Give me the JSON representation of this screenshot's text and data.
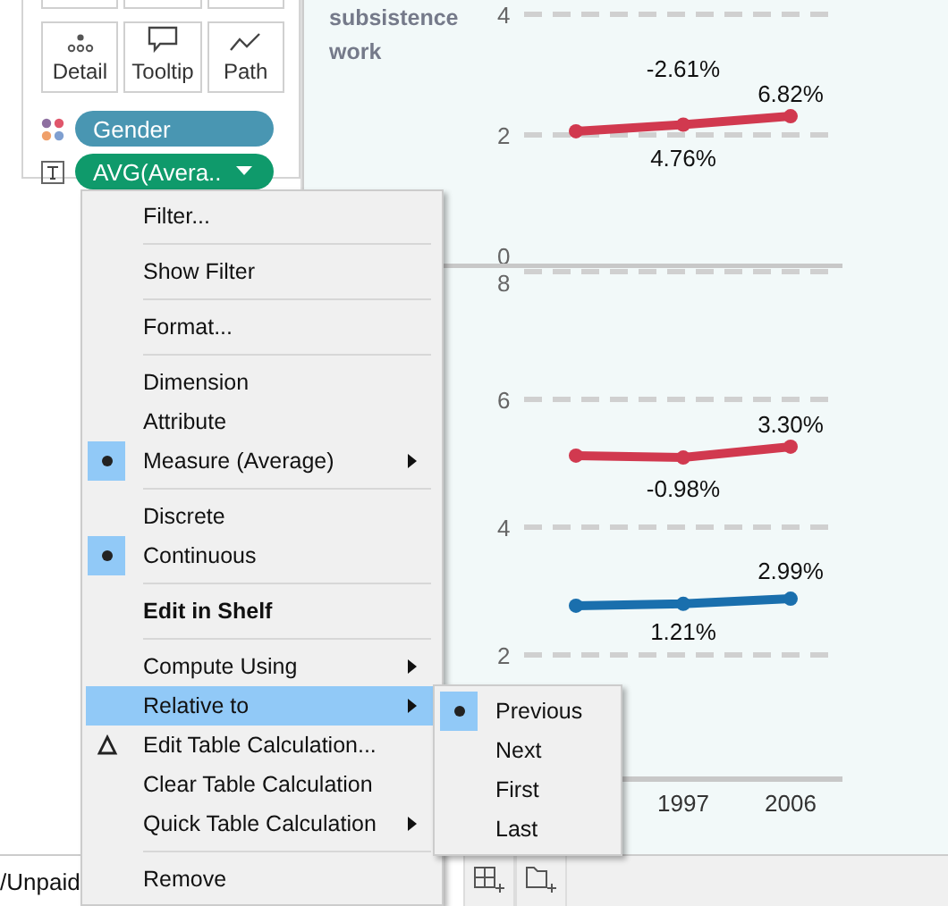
{
  "marks_card": {
    "buttons": [
      {
        "label": "Detail"
      },
      {
        "label": "Tooltip"
      },
      {
        "label": "Path"
      }
    ],
    "pills": [
      {
        "label": "Gender",
        "color": "#4996b2",
        "dropdown": false
      },
      {
        "label": "AVG(Avera..",
        "color": "#0f9a6b",
        "dropdown": true
      }
    ]
  },
  "row_header": "subsistence work",
  "panes": [
    {
      "chart_data": {
        "type": "line",
        "ylim": [
          0,
          4
        ],
        "yticks": [
          0,
          2,
          4
        ],
        "grid": true,
        "series": [
          {
            "color": "#d1394f",
            "marker": "circle",
            "values": [
              2.06,
              2.17,
              2.31
            ]
          }
        ],
        "annotations": [
          "-2.61%",
          "6.82%",
          "4.76%"
        ]
      }
    },
    {
      "chart_data": {
        "type": "line",
        "categories": [
          null,
          "1997",
          "2006"
        ],
        "ylim": [
          0,
          8
        ],
        "yticks": [
          2,
          4,
          6,
          8
        ],
        "grid": true,
        "series": [
          {
            "color": "#d1394f",
            "marker": "circle",
            "values": [
              5.12,
              5.09,
              5.26
            ]
          },
          {
            "color": "#1a6fad",
            "marker": "circle",
            "values": [
              2.77,
              2.8,
              2.88
            ]
          }
        ],
        "annotations": [
          "3.30%",
          "-0.98%",
          "2.99%",
          "1.21%"
        ]
      }
    }
  ],
  "sheet_tab": "/Unpaid",
  "menu": {
    "items": [
      {
        "kind": "item",
        "label": "Filter...",
        "highlighted": false
      },
      {
        "kind": "separator"
      },
      {
        "kind": "item",
        "label": "Show Filter",
        "highlighted": false
      },
      {
        "kind": "separator"
      },
      {
        "kind": "item",
        "label": "Format...",
        "highlighted": false
      },
      {
        "kind": "separator"
      },
      {
        "kind": "radio",
        "label": "Dimension",
        "selected": false,
        "highlighted": false
      },
      {
        "kind": "radio",
        "label": "Attribute",
        "selected": false,
        "highlighted": false
      },
      {
        "kind": "radio",
        "label": "Measure (Average)",
        "selected": true,
        "submenu": true,
        "highlighted": false
      },
      {
        "kind": "separator"
      },
      {
        "kind": "radio",
        "label": "Discrete",
        "selected": false,
        "highlighted": false
      },
      {
        "kind": "radio",
        "label": "Continuous",
        "selected": true,
        "highlighted": false
      },
      {
        "kind": "separator"
      },
      {
        "kind": "bold",
        "label": "Edit in Shelf",
        "highlighted": false
      },
      {
        "kind": "separator"
      },
      {
        "kind": "item",
        "label": "Compute Using",
        "submenu": true,
        "highlighted": false
      },
      {
        "kind": "item",
        "label": "Relative to",
        "submenu": true,
        "highlighted": true
      },
      {
        "kind": "calc",
        "label": "Edit Table Calculation...",
        "highlighted": false
      },
      {
        "kind": "item",
        "label": "Clear Table Calculation",
        "highlighted": false
      },
      {
        "kind": "item",
        "label": "Quick Table Calculation",
        "submenu": true,
        "highlighted": false
      },
      {
        "kind": "separator"
      },
      {
        "kind": "item",
        "label": "Remove",
        "highlighted": false
      }
    ]
  },
  "submenu": {
    "items": [
      {
        "label": "Previous",
        "selected": true
      },
      {
        "label": "Next",
        "selected": false
      },
      {
        "label": "First",
        "selected": false
      },
      {
        "label": "Last",
        "selected": false
      }
    ]
  }
}
